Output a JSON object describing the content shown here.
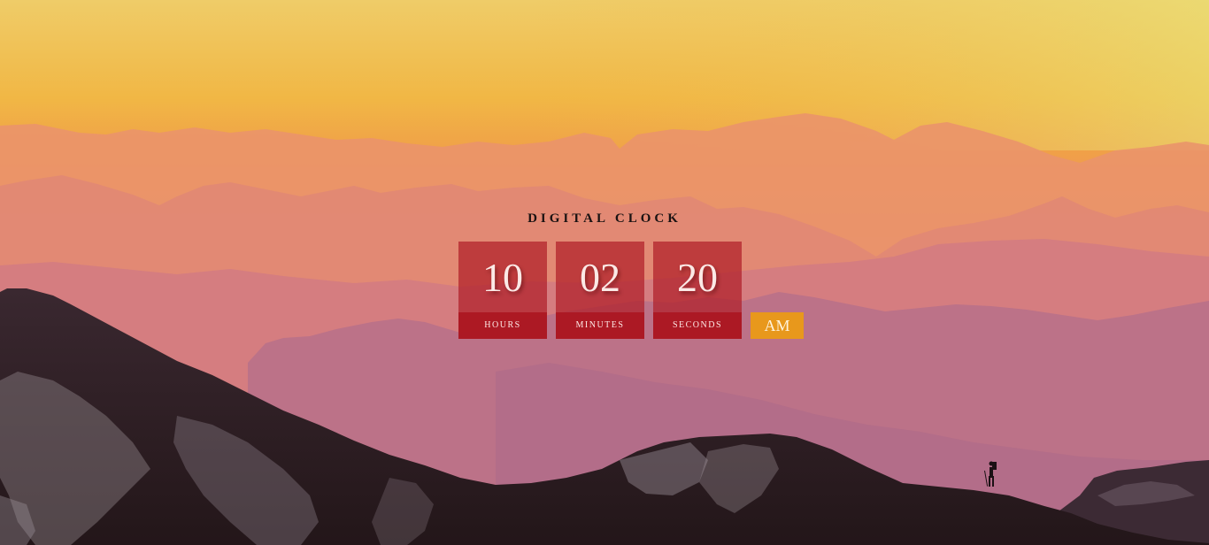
{
  "title": "DIGITAL CLOCK",
  "clock": {
    "hours": "10",
    "minutes": "02",
    "seconds": "20",
    "period": "AM"
  },
  "labels": {
    "hours": "HOURS",
    "minutes": "MINUTES",
    "seconds": "SECONDS"
  },
  "colors": {
    "sky_top": "#efd56e",
    "sky_mid": "#f1b545",
    "clock_box": "#b01e28",
    "ampm_box": "#e8981c"
  }
}
